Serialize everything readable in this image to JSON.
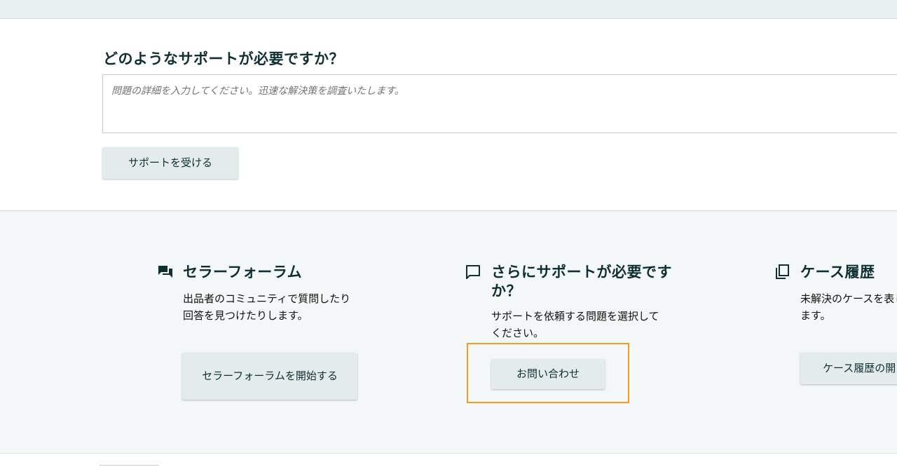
{
  "help": {
    "title": "どのようなサポートが必要ですか？",
    "textarea_placeholder": "問題の詳細を入力してください。迅速な解決策を調査いたします。",
    "button_label": "サポートを受ける"
  },
  "cards": {
    "forum": {
      "icon": "forum-chat-icon",
      "title": "セラーフォーラム",
      "description": "出品者のコミュニティで質問したり回答を見つけたりします。",
      "button_label": "セラーフォーラムを開始する"
    },
    "more_support": {
      "icon": "chat-bubble-icon",
      "title": "さらにサポートが必要ですか？",
      "description": "サポートを依頼する問題を選択してください。",
      "button_label": "お問い合わせ",
      "highlight_color": "#f39c1f"
    },
    "case_history": {
      "icon": "copy-icon",
      "title": "ケース履歴",
      "description": "未解決のケースを表します。",
      "button_label": "ケース履歴の開"
    }
  },
  "colors": {
    "top_strip": "#e8f0f1",
    "cards_background": "#f4f7f7",
    "button_background": "#e3ebeb",
    "heading_text": "#0f2f33"
  }
}
